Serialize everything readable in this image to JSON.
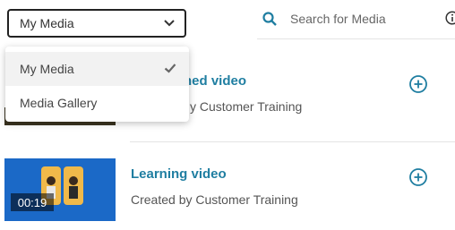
{
  "media_select": {
    "value": "My Media"
  },
  "search": {
    "placeholder": "Search for Media"
  },
  "dropdown": {
    "options": [
      {
        "label": "My Media",
        "selected": true
      },
      {
        "label": "Media Gallery",
        "selected": false
      }
    ]
  },
  "media_items": [
    {
      "title": "ned video",
      "created_by": "y Customer Training",
      "duration": ""
    },
    {
      "title": "Learning video",
      "created_by": "Created by Customer Training",
      "duration": "00:19"
    }
  ],
  "icons": {
    "select": "chevron-down-icon",
    "search": "search-icon",
    "info": "info-icon",
    "add": "add-circle-icon",
    "check": "checkmark-icon"
  },
  "colors": {
    "accent": "#1f7ea1",
    "thumbnail_blue": "#1b69c7"
  }
}
